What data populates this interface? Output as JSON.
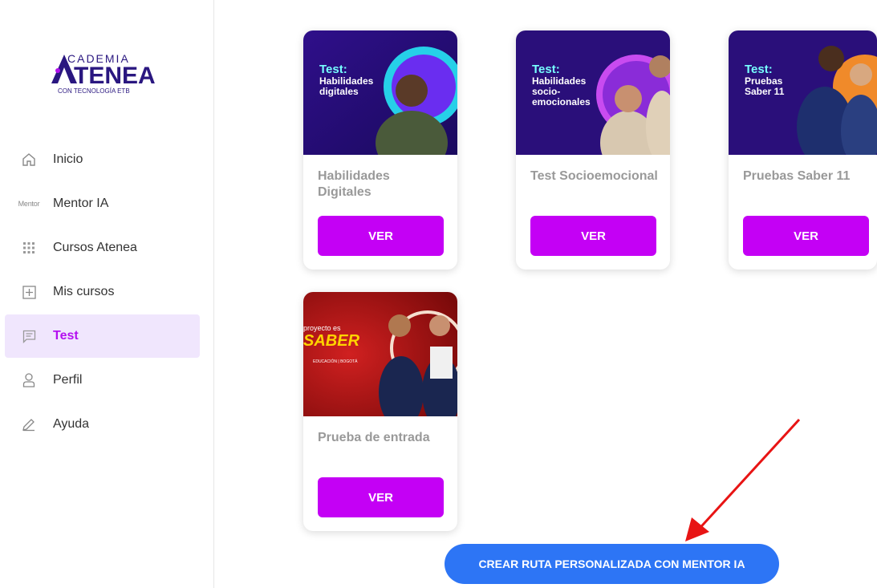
{
  "logo": {
    "line1": "CADEMIA",
    "line2": "TENEA",
    "line3": "CON TECNOLOGÍA ETB"
  },
  "sidebar": {
    "items": [
      {
        "label": "Inicio",
        "icon": "home-icon"
      },
      {
        "label": "Mentor IA",
        "icon": "mentor-icon",
        "icon_text": "Mentor"
      },
      {
        "label": "Cursos Atenea",
        "icon": "grid-icon"
      },
      {
        "label": "Mis cursos",
        "icon": "plus-square-icon"
      },
      {
        "label": "Test",
        "icon": "message-icon",
        "active": true
      },
      {
        "label": "Perfil",
        "icon": "user-icon"
      },
      {
        "label": "Ayuda",
        "icon": "pencil-icon"
      }
    ]
  },
  "cards": [
    {
      "title": "Habilidades Digitales",
      "button": "VER",
      "img_test": "Test:",
      "img_subtitle": "Habilidades digitales"
    },
    {
      "title": "Test Socioemocional",
      "button": "VER",
      "img_test": "Test:",
      "img_subtitle": "Habilidades socio-emocionales"
    },
    {
      "title": "Pruebas Saber 11",
      "button": "VER",
      "img_test": "Test:",
      "img_subtitle": "Pruebas Saber 11"
    },
    {
      "title": "Prueba de entrada",
      "button": "VER",
      "img_top": "proyecto es",
      "img_brand": "SABER",
      "img_footer1": "EDUCACIÓN",
      "img_footer2": "BOGOTÁ"
    }
  ],
  "cta": {
    "label": "CREAR RUTA PERSONALIZADA CON MENTOR IA"
  },
  "colors": {
    "accent": "#c400f5",
    "cta": "#2d75f5",
    "active_bg": "#f0e6fd",
    "card_bg_dark": "#2a0f7a"
  }
}
